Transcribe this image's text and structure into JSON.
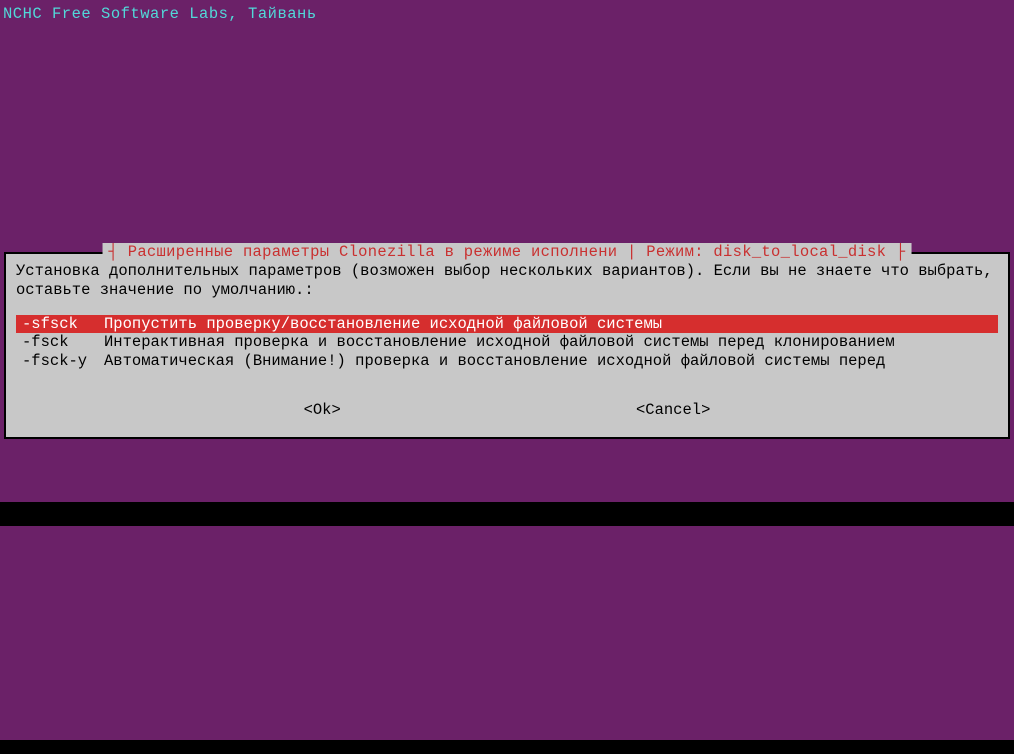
{
  "header": "NCHC Free Software Labs, Тайвань",
  "dialog": {
    "title": "Расширенные параметры Clonezilla в режиме исполнени | Режим: disk_to_local_disk",
    "instruction": "Установка дополнительных параметров (возможен выбор нескольких вариантов). Если вы не знаете что выбрать, оставьте значение по умолчанию.:",
    "options": [
      {
        "flag": "-sfsck",
        "desc": "Пропустить проверку/восстановление исходной файловой системы",
        "selected": true
      },
      {
        "flag": "-fsck",
        "desc": "Интерактивная проверка и восстановление исходной файловой системы перед клонированием",
        "selected": false
      },
      {
        "flag": "-fsck-y",
        "desc": "Автоматическая (Внимание!) проверка и восстановление исходной файловой системы перед",
        "selected": false
      }
    ],
    "ok": "<Ok>",
    "cancel": "<Cancel>"
  }
}
